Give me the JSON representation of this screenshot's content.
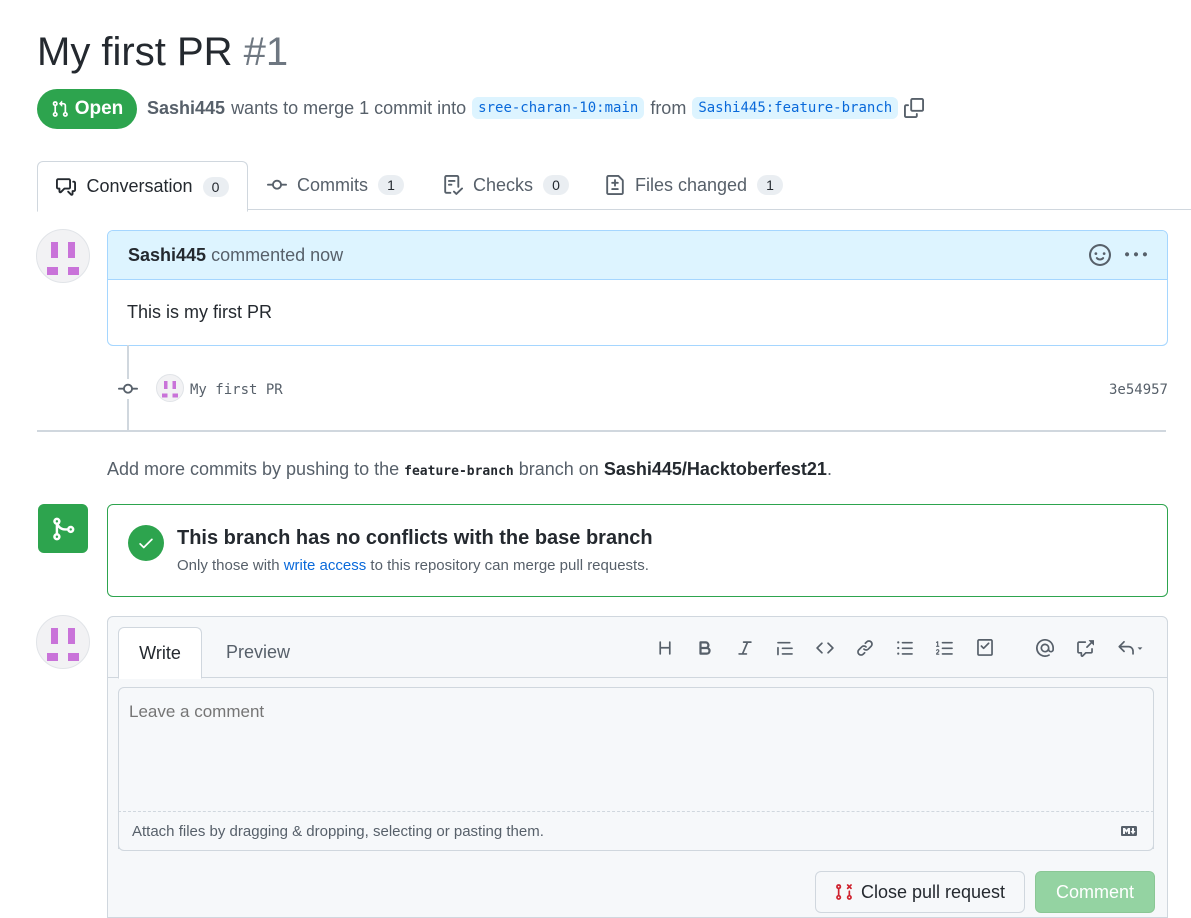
{
  "pr": {
    "title": "My first PR",
    "number": "#1",
    "state": "Open",
    "author": "Sashi445",
    "merge_text": "wants to merge 1 commit into",
    "base_branch": "sree-charan-10:main",
    "from_text": "from",
    "head_branch": "Sashi445:feature-branch"
  },
  "tabs": [
    {
      "label": "Conversation",
      "count": "0"
    },
    {
      "label": "Commits",
      "count": "1"
    },
    {
      "label": "Checks",
      "count": "0"
    },
    {
      "label": "Files changed",
      "count": "1"
    }
  ],
  "comment": {
    "author": "Sashi445",
    "time": "commented now",
    "body": "This is my first PR"
  },
  "commit": {
    "message": "My first PR",
    "sha": "3e54957"
  },
  "hint": {
    "prefix": "Add more commits by pushing to the",
    "branch": "feature-branch",
    "middle": "branch on",
    "repo": "Sashi445/Hacktoberfest21",
    "suffix": "."
  },
  "merge": {
    "title": "This branch has no conflicts with the base branch",
    "sub_prefix": "Only those with",
    "sub_link": "write access",
    "sub_suffix": "to this repository can merge pull requests."
  },
  "editor": {
    "tab_write": "Write",
    "tab_preview": "Preview",
    "placeholder": "Leave a comment",
    "attach_text": "Attach files by dragging & dropping, selecting or pasting them.",
    "close_label": "Close pull request",
    "comment_label": "Comment"
  },
  "colors": {
    "green": "#2da44e",
    "blue": "#0969da",
    "branch_bg": "#ddf4ff"
  }
}
